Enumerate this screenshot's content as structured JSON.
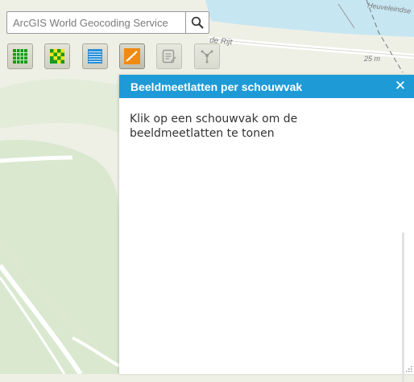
{
  "search": {
    "placeholder": "ArcGIS World Geocoding Service",
    "button_icon": "search-icon"
  },
  "toolbar": {
    "tools": [
      {
        "icon": "green-grid-icon",
        "state": "normal"
      },
      {
        "icon": "yellow-green-grid-icon",
        "state": "normal"
      },
      {
        "icon": "blue-list-icon",
        "state": "normal"
      },
      {
        "icon": "orange-measure-icon",
        "state": "active"
      },
      {
        "icon": "edit-note-icon",
        "state": "disabled"
      },
      {
        "icon": "network-icon",
        "state": "disabled"
      }
    ]
  },
  "map": {
    "labels": {
      "street": "de Rijt",
      "place": "Heuveleindse",
      "distance": "25 m"
    },
    "colors": {
      "land": "#eef0e6",
      "park": "#d9e8cf",
      "water": "#c6e6f2",
      "road": "#ffffff"
    }
  },
  "panel": {
    "title": "Beeldmeetlatten per schouwvak",
    "close_icon": "close-icon",
    "message": "Klik op een schouwvak om de beeldmeetlatten te tonen",
    "header_color": "#1e9bd7"
  }
}
